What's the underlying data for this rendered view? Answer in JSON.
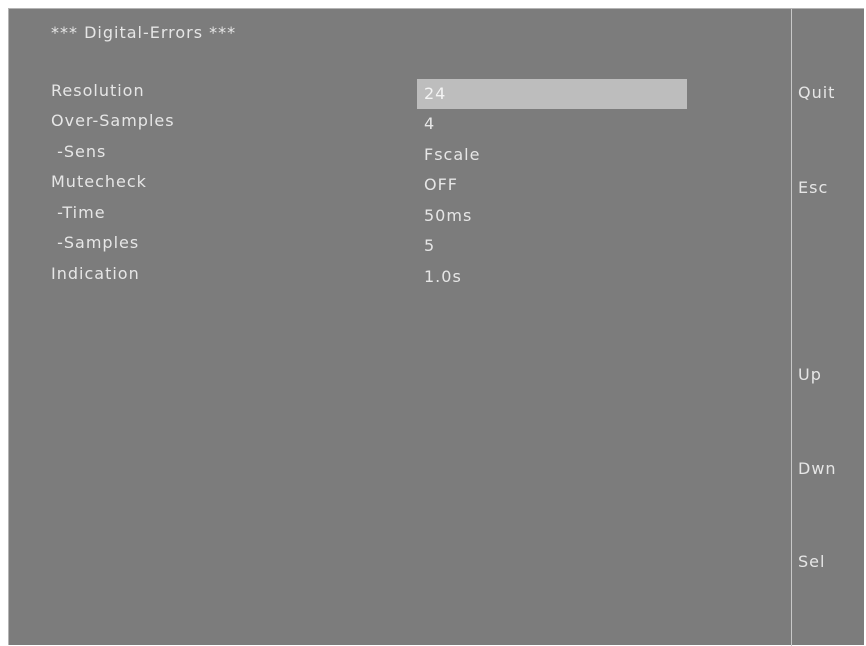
{
  "screen": {
    "title": "*** Digital-Errors ***"
  },
  "params": [
    {
      "label": "Resolution",
      "value": "24"
    },
    {
      "label": "Over-Samples",
      "value": "4"
    },
    {
      "label": " -Sens",
      "value": "Fscale"
    },
    {
      "label": "Mutecheck",
      "value": "OFF"
    },
    {
      "label": " -Time",
      "value": "50ms"
    },
    {
      "label": " -Samples",
      "value": "5"
    },
    {
      "label": "Indication",
      "value": "1.0s"
    }
  ],
  "selected_param_index": 0,
  "softkeys": {
    "quit": "Quit",
    "esc": "Esc",
    "up": "Up",
    "dwn": "Dwn",
    "sel": "Sel"
  },
  "colors": {
    "background": "#7c7c7c",
    "text": "#e6e6e6",
    "highlight": "#bdbdbd"
  }
}
